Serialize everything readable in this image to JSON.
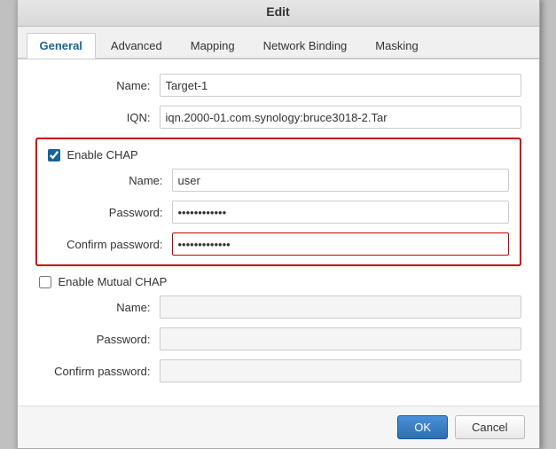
{
  "dialog": {
    "title": "Edit",
    "tabs": [
      {
        "label": "General",
        "active": true
      },
      {
        "label": "Advanced",
        "active": false
      },
      {
        "label": "Mapping",
        "active": false
      },
      {
        "label": "Network Binding",
        "active": false
      },
      {
        "label": "Masking",
        "active": false
      }
    ]
  },
  "form": {
    "name_label": "Name:",
    "name_value": "Target-1",
    "iqn_label": "IQN:",
    "iqn_value": "iqn.2000-01.com.synology:bruce3018-2.Tar",
    "enable_chap_label": "Enable CHAP",
    "chap_name_label": "Name:",
    "chap_name_value": "user",
    "chap_password_label": "Password:",
    "chap_password_value": "············",
    "chap_confirm_label": "Confirm password:",
    "chap_confirm_value": "·············",
    "enable_mutual_label": "Enable Mutual CHAP",
    "mutual_name_label": "Name:",
    "mutual_name_value": "",
    "mutual_password_label": "Password:",
    "mutual_password_value": "",
    "mutual_confirm_label": "Confirm password:",
    "mutual_confirm_value": ""
  },
  "footer": {
    "ok_label": "OK",
    "cancel_label": "Cancel"
  }
}
